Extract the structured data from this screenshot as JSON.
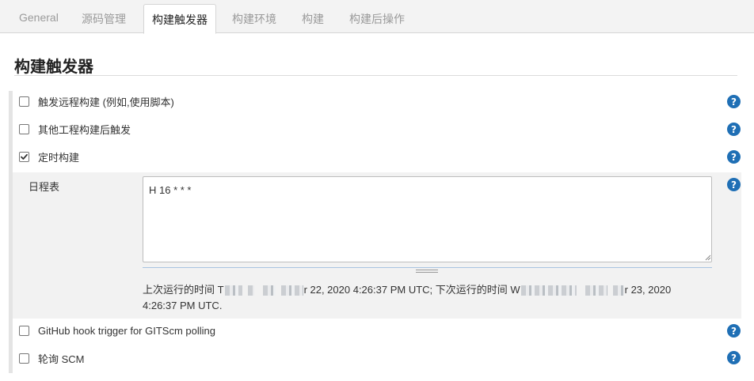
{
  "tabs": [
    {
      "label": "General",
      "active": false
    },
    {
      "label": "源码管理",
      "active": false
    },
    {
      "label": "构建触发器",
      "active": true
    },
    {
      "label": "构建环境",
      "active": false
    },
    {
      "label": "构建",
      "active": false
    },
    {
      "label": "构建后操作",
      "active": false
    }
  ],
  "section": {
    "title": "构建触发器"
  },
  "triggers": [
    {
      "label": "触发远程构建 (例如,使用脚本)",
      "checked": false
    },
    {
      "label": "其他工程构建后触发",
      "checked": false
    },
    {
      "label": "定时构建",
      "checked": true
    },
    {
      "label": "GitHub hook trigger for GITScm polling",
      "checked": false
    },
    {
      "label": "轮询 SCM",
      "checked": false
    }
  ],
  "schedule": {
    "label": "日程表",
    "value": "H 16 * * *"
  },
  "run_info": {
    "last_prefix": "上次运行的时间 T",
    "last_suffix": "r 22, 2020 4:26:37 PM UTC; 下次运行的时间 W",
    "next_suffix": "r 23, 2020",
    "line2": "4:26:37 PM UTC."
  },
  "help_icon_glyph": "?",
  "colors": {
    "help_icon": "#1f6fb5",
    "active_tab_text": "#222222",
    "inactive_tab_text": "#9a9a9a"
  }
}
